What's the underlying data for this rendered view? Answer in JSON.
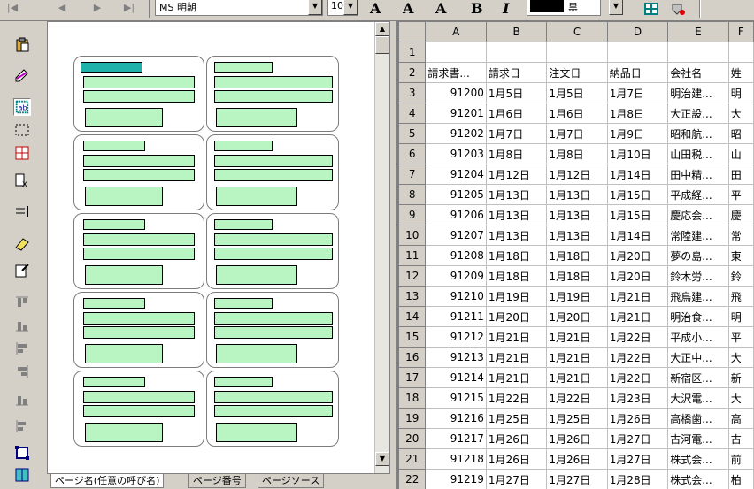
{
  "toolbar": {
    "font_name": "MS 明朝",
    "font_size": "10",
    "format_letters": [
      "A",
      "A",
      "A",
      "B",
      "I"
    ],
    "color_label": "黒"
  },
  "tabs": [
    "ページ名(任意の呼び名)",
    "ページ番号",
    "ページソース"
  ],
  "sheet": {
    "columns": [
      "A",
      "B",
      "C",
      "D",
      "E",
      "F"
    ],
    "header_row": [
      "請求書...",
      "請求日",
      "注文日",
      "納品日",
      "会社名",
      "姓"
    ],
    "rows": [
      [
        "91200",
        "1月5日",
        "1月5日",
        "1月7日",
        "明治建...",
        "明"
      ],
      [
        "91201",
        "1月6日",
        "1月6日",
        "1月8日",
        "大正設...",
        "大"
      ],
      [
        "91202",
        "1月7日",
        "1月7日",
        "1月9日",
        "昭和航...",
        "昭"
      ],
      [
        "91203",
        "1月8日",
        "1月8日",
        "1月10日",
        "山田税...",
        "山"
      ],
      [
        "91204",
        "1月12日",
        "1月12日",
        "1月14日",
        "田中精...",
        "田"
      ],
      [
        "91205",
        "1月13日",
        "1月13日",
        "1月15日",
        "平成経...",
        "平"
      ],
      [
        "91206",
        "1月13日",
        "1月13日",
        "1月15日",
        "慶応会...",
        "慶"
      ],
      [
        "91207",
        "1月13日",
        "1月13日",
        "1月14日",
        "常陸建...",
        "常"
      ],
      [
        "91208",
        "1月18日",
        "1月18日",
        "1月20日",
        "夢の島...",
        "東"
      ],
      [
        "91209",
        "1月18日",
        "1月18日",
        "1月20日",
        "鈴木労...",
        "鈴"
      ],
      [
        "91210",
        "1月19日",
        "1月19日",
        "1月21日",
        "飛鳥建...",
        "飛"
      ],
      [
        "91211",
        "1月20日",
        "1月20日",
        "1月21日",
        "明治食...",
        "明"
      ],
      [
        "91212",
        "1月21日",
        "1月21日",
        "1月22日",
        "平成小...",
        "平"
      ],
      [
        "91213",
        "1月21日",
        "1月21日",
        "1月22日",
        "大正中...",
        "大"
      ],
      [
        "91214",
        "1月21日",
        "1月21日",
        "1月22日",
        "新宿区...",
        "新"
      ],
      [
        "91215",
        "1月22日",
        "1月22日",
        "1月23日",
        "大沢電...",
        "大"
      ],
      [
        "91216",
        "1月25日",
        "1月25日",
        "1月26日",
        "高橋歯...",
        "高"
      ],
      [
        "91217",
        "1月26日",
        "1月26日",
        "1月27日",
        "古河電...",
        "古"
      ],
      [
        "91218",
        "1月26日",
        "1月26日",
        "1月27日",
        "株式会...",
        "前"
      ],
      [
        "91219",
        "1月27日",
        "1月27日",
        "1月28日",
        "株式会...",
        "柏"
      ]
    ]
  },
  "icons": {
    "vertical_tools": [
      "paste-icon",
      "edit-icon",
      "text-field-icon",
      "select-rect-icon",
      "grid-icon",
      "delete-field-icon",
      "align-icon",
      "eraser-icon",
      "properties-icon",
      "align-top-icon",
      "align-bottom-icon",
      "align-left-icon",
      "align-right-icon",
      "distribute-h-icon",
      "distribute-v-icon",
      "fit-icon",
      "layout-icon"
    ]
  }
}
